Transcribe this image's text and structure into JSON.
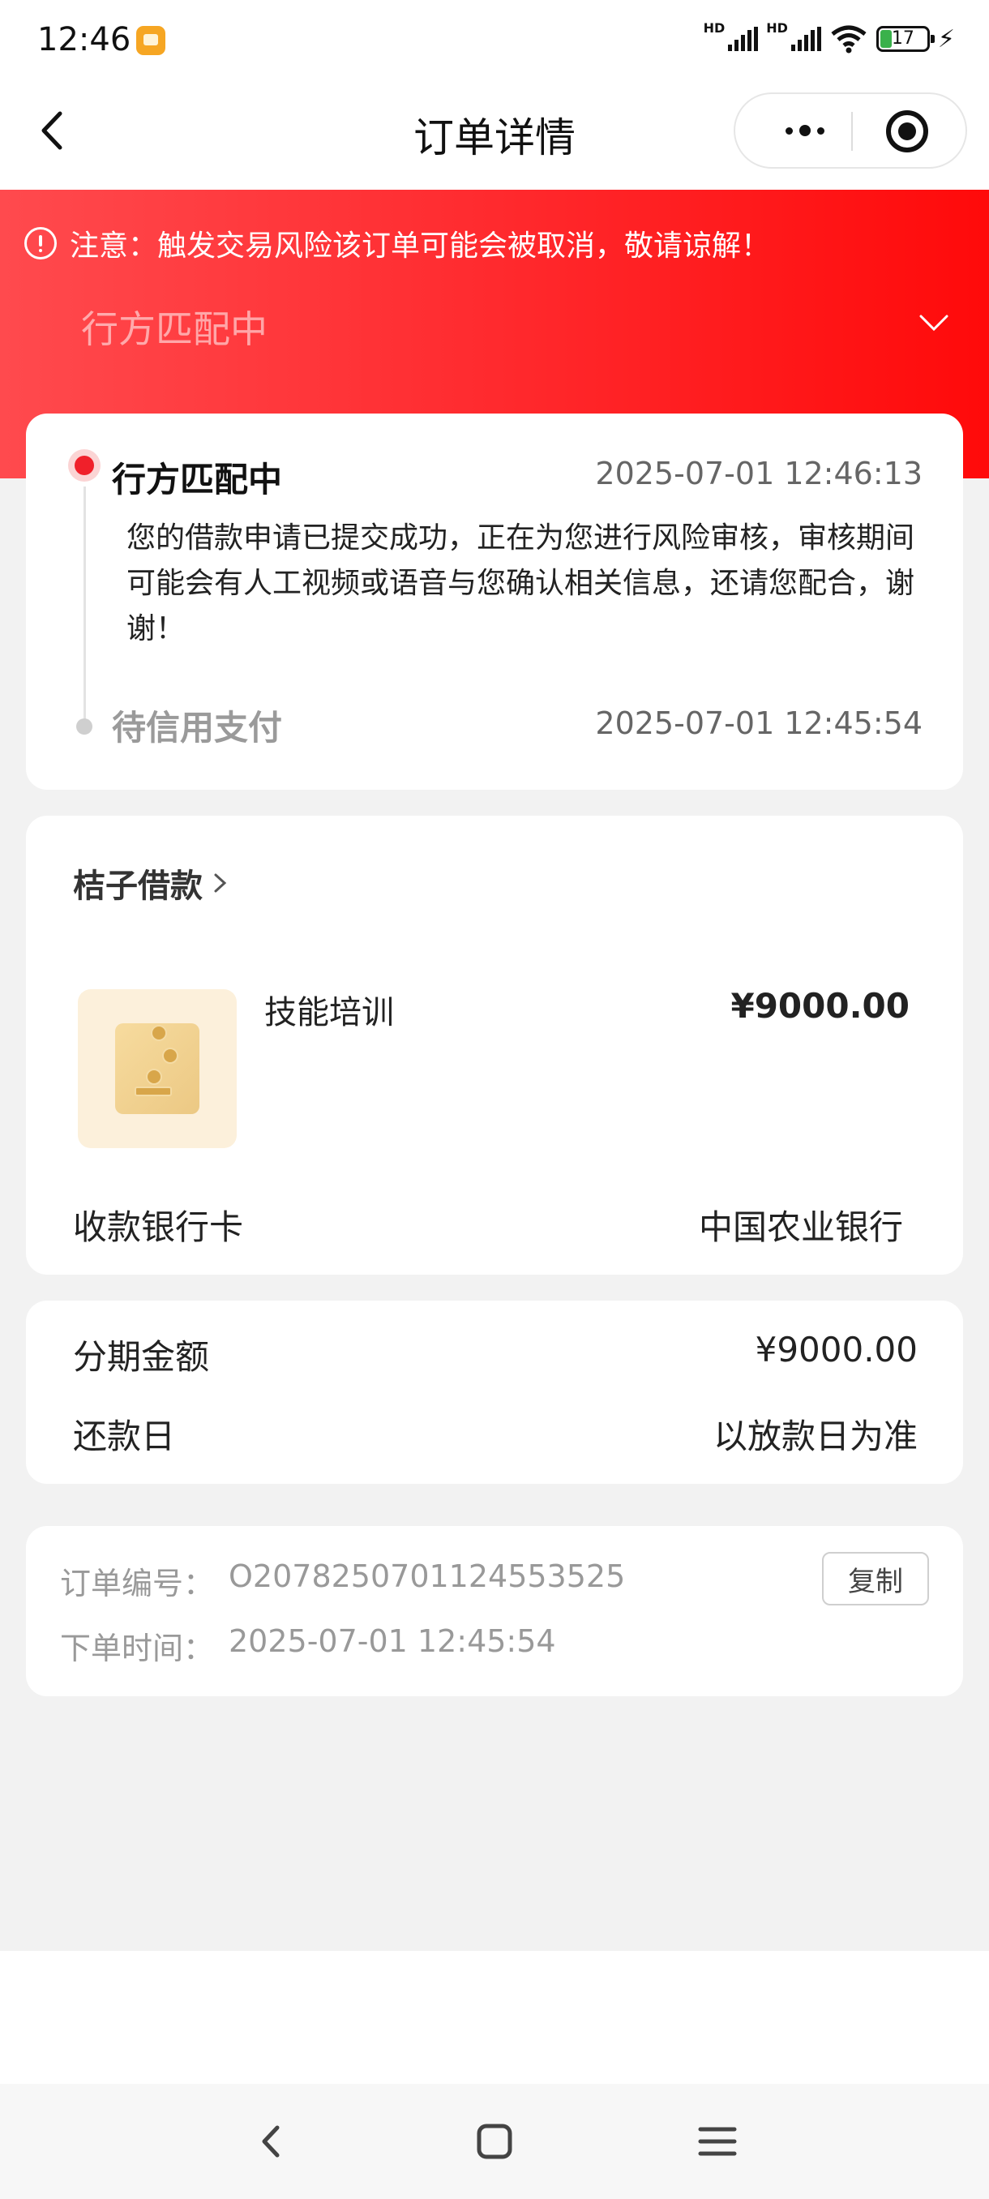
{
  "status_bar": {
    "time": "12:46",
    "net1": "HD",
    "net2": "HD",
    "battery": "17"
  },
  "header": {
    "title": "订单详情"
  },
  "banner": {
    "warning": "注意：触发交易风险该订单可能会被取消，敬请谅解！",
    "status": "行方匹配中"
  },
  "timeline": {
    "steps": [
      {
        "title": "行方匹配中",
        "time": "2025-07-01 12:46:13",
        "desc": "您的借款申请已提交成功，正在为您进行风险审核，审核期间可能会有人工视频或语音与您确认相关信息，还请您配合，谢谢！"
      },
      {
        "title": "待信用支付",
        "time": "2025-07-01 12:45:54"
      }
    ]
  },
  "product": {
    "merchant": "桔子借款",
    "name": "技能培训",
    "price": "¥9000.00",
    "bank_label": "收款银行卡",
    "bank_value": "中国农业银行"
  },
  "installment": {
    "amount_label": "分期金额",
    "amount_value": "¥9000.00",
    "repay_label": "还款日",
    "repay_value": "以放款日为准"
  },
  "order_info": {
    "number_label": "订单编号：",
    "number_value": "O2078250701124553525",
    "copy_label": "复制",
    "time_label": "下单时间：",
    "time_value": "2025-07-01 12:45:54"
  },
  "colors": {
    "accent": "#ff1e22",
    "page_bg": "#f2f2f2"
  },
  "icons": [
    "back-icon",
    "more-icon",
    "close-miniprogram-icon",
    "warning-icon",
    "chevron-down-icon",
    "chevron-right-icon",
    "nav-back-icon",
    "nav-home-icon",
    "nav-menu-icon"
  ]
}
